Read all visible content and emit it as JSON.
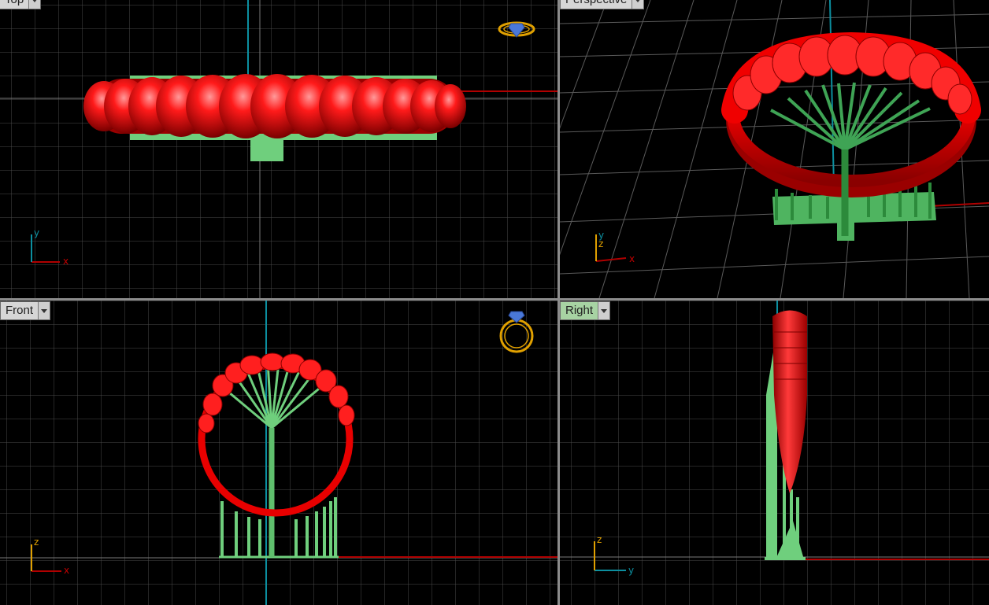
{
  "viewports": {
    "top": {
      "label": "Top",
      "axis_h": "x",
      "axis_v": "y",
      "active": false
    },
    "perspective": {
      "label": "Perspective",
      "axis_h": "x",
      "axis_v": "y",
      "axis_v2": "z",
      "active": false
    },
    "front": {
      "label": "Front",
      "axis_h": "x",
      "axis_v": "z",
      "active": false
    },
    "right": {
      "label": "Right",
      "axis_h": "y",
      "axis_v": "z",
      "active": true
    }
  },
  "icons": {
    "top_view_icon": "ring-top-view-icon",
    "front_view_icon": "ring-front-view-icon"
  },
  "colors": {
    "background": "#000000",
    "grid": "#4a4a4a",
    "grid_major": "#7a7a7a",
    "x_axis": "#b00000",
    "y_axis": "#0c8fa0",
    "ring": "#e80000",
    "supports": "#6fcf7d",
    "label_bg": "#d6d6d6",
    "label_active_bg": "#a7d3a3",
    "ring_icon": "#e0a000",
    "gem_icon": "#4a78d8"
  }
}
